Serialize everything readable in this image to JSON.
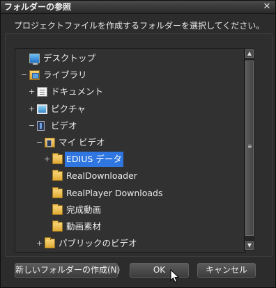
{
  "window": {
    "title": "フォルダーの参照",
    "close_glyph": "✕"
  },
  "instruction": "プロジェクトファイルを作成するフォルダーを選択してください。",
  "tree": [
    {
      "id": "desktop",
      "label": "デスクトップ",
      "expander": "",
      "icon": "monitor-icon"
    },
    {
      "id": "library",
      "label": "ライブラリ",
      "expander": "−",
      "icon": "library-icon"
    },
    {
      "id": "documents",
      "label": "ドキュメント",
      "expander": "+",
      "icon": "docs-icon"
    },
    {
      "id": "pictures",
      "label": "ピクチャ",
      "expander": "+",
      "icon": "pictures-icon"
    },
    {
      "id": "videos",
      "label": "ビデオ",
      "expander": "−",
      "icon": "film-icon"
    },
    {
      "id": "my-videos",
      "label": "マイ ビデオ",
      "expander": "−",
      "icon": "myvideo-icon"
    },
    {
      "id": "edius-data",
      "label": "EDIUS データ",
      "expander": "+",
      "icon": "folder-icon",
      "selected": true
    },
    {
      "id": "realdownloader",
      "label": "RealDownloader",
      "expander": "",
      "icon": "folder-icon"
    },
    {
      "id": "realplayer-downloads",
      "label": "RealPlayer Downloads",
      "expander": "",
      "icon": "folder-icon"
    },
    {
      "id": "finished-video",
      "label": "完成動画",
      "expander": "",
      "icon": "folder-icon"
    },
    {
      "id": "video-material",
      "label": "動画素材",
      "expander": "",
      "icon": "folder-icon"
    },
    {
      "id": "public-videos",
      "label": "パブリックのビデオ",
      "expander": "+",
      "icon": "folder-icon"
    }
  ],
  "scrollbar": {
    "up_glyph": "▲",
    "down_glyph": "▼"
  },
  "buttons": {
    "new_folder": "新しいフォルダーの作成(N)",
    "ok": "OK",
    "cancel": "キャンセル"
  }
}
